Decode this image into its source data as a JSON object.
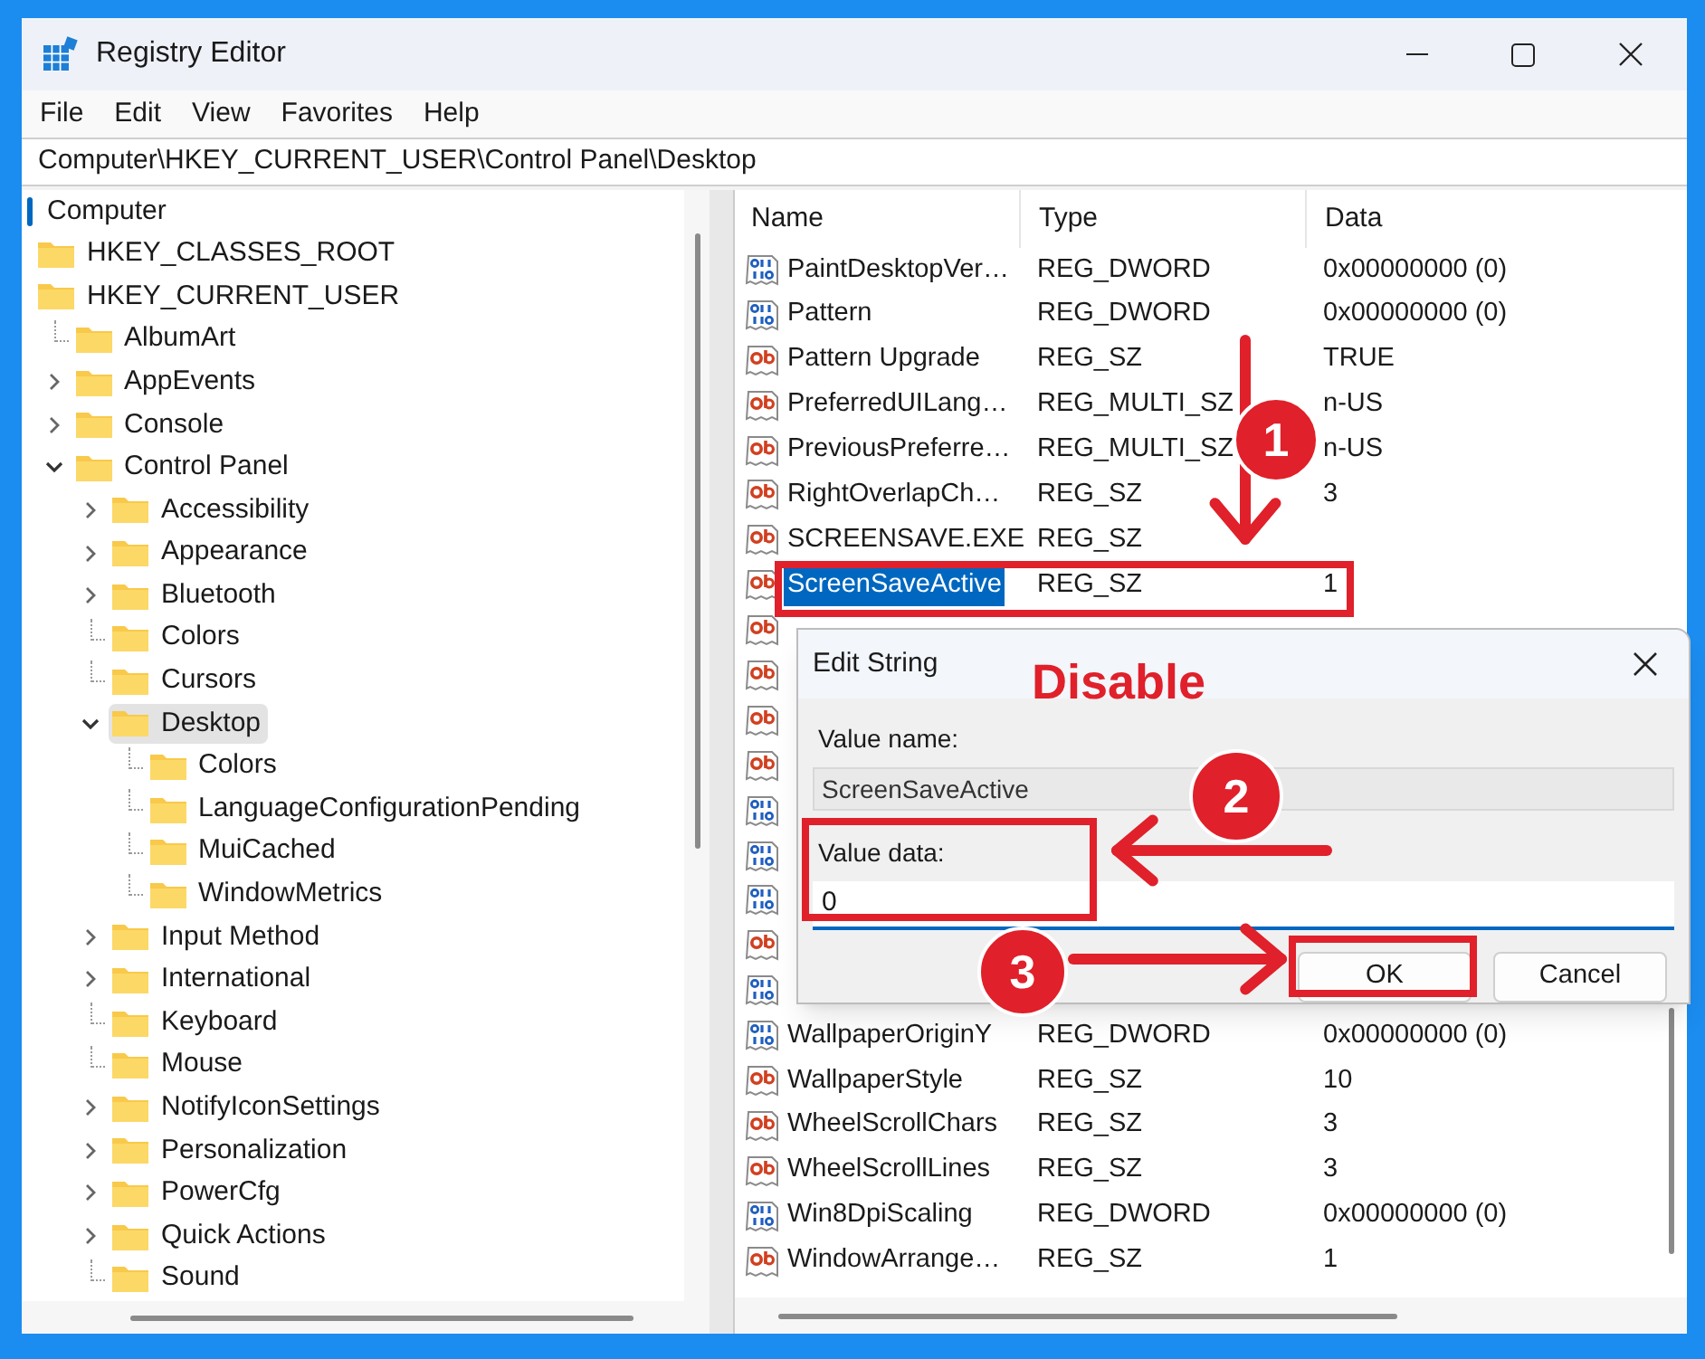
{
  "window": {
    "title": "Registry Editor"
  },
  "menu": [
    "File",
    "Edit",
    "View",
    "Favorites",
    "Help"
  ],
  "address": "Computer\\HKEY_CURRENT_USER\\Control Panel\\Desktop",
  "tree": {
    "label": "Computer",
    "selected": false,
    "children": [
      {
        "label": "HKEY_CLASSES_ROOT",
        "kind": "root",
        "selected": false
      },
      {
        "label": "HKEY_CURRENT_USER",
        "kind": "root",
        "selected": false,
        "children": [
          {
            "label": "AlbumArt",
            "kind": "leaf",
            "selected": false
          },
          {
            "label": "AppEvents",
            "kind": "branch",
            "expanded": false,
            "selected": false
          },
          {
            "label": "Console",
            "kind": "branch",
            "expanded": false,
            "selected": false
          },
          {
            "label": "Control Panel",
            "kind": "branch",
            "expanded": true,
            "selected": false,
            "children": [
              {
                "label": "Accessibility",
                "kind": "branch",
                "expanded": false,
                "selected": false
              },
              {
                "label": "Appearance",
                "kind": "branch",
                "expanded": false,
                "selected": false
              },
              {
                "label": "Bluetooth",
                "kind": "branch",
                "expanded": false,
                "selected": false
              },
              {
                "label": "Colors",
                "kind": "leaf",
                "selected": false
              },
              {
                "label": "Cursors",
                "kind": "leaf",
                "selected": false
              },
              {
                "label": "Desktop",
                "kind": "branch",
                "expanded": true,
                "selected": true,
                "children": [
                  {
                    "label": "Colors",
                    "kind": "leaf",
                    "selected": false
                  },
                  {
                    "label": "LanguageConfigurationPending",
                    "kind": "leaf",
                    "selected": false
                  },
                  {
                    "label": "MuiCached",
                    "kind": "leaf",
                    "selected": false
                  },
                  {
                    "label": "WindowMetrics",
                    "kind": "leaf",
                    "selected": false
                  }
                ]
              },
              {
                "label": "Input Method",
                "kind": "branch",
                "expanded": false,
                "selected": false
              },
              {
                "label": "International",
                "kind": "branch",
                "expanded": false,
                "selected": false
              },
              {
                "label": "Keyboard",
                "kind": "leaf",
                "selected": false
              },
              {
                "label": "Mouse",
                "kind": "leaf",
                "selected": false
              },
              {
                "label": "NotifyIconSettings",
                "kind": "branch",
                "expanded": false,
                "selected": false
              },
              {
                "label": "Personalization",
                "kind": "branch",
                "expanded": false,
                "selected": false
              },
              {
                "label": "PowerCfg",
                "kind": "branch",
                "expanded": false,
                "selected": false
              },
              {
                "label": "Quick Actions",
                "kind": "branch",
                "expanded": false,
                "selected": false
              },
              {
                "label": "Sound",
                "kind": "leaf",
                "selected": false
              }
            ]
          }
        ]
      }
    ]
  },
  "list": {
    "columns": [
      "Name",
      "Type",
      "Data"
    ],
    "rows": [
      {
        "kind": "dword",
        "name": "PaintDesktopVer…",
        "type": "REG_DWORD",
        "data": "0x00000000 (0)",
        "selected": false
      },
      {
        "kind": "dword",
        "name": "Pattern",
        "type": "REG_DWORD",
        "data": "0x00000000 (0)",
        "selected": false
      },
      {
        "kind": "string",
        "name": "Pattern Upgrade",
        "type": "REG_SZ",
        "data": "TRUE",
        "selected": false
      },
      {
        "kind": "string",
        "name": "PreferredUILang…",
        "type": "REG_MULTI_SZ",
        "data": "n-US",
        "selected": false
      },
      {
        "kind": "string",
        "name": "PreviousPreferre…",
        "type": "REG_MULTI_SZ",
        "data": "n-US",
        "selected": false
      },
      {
        "kind": "string",
        "name": "RightOverlapCh…",
        "type": "REG_SZ",
        "data": "3",
        "selected": false
      },
      {
        "kind": "string",
        "name": "SCREENSAVE.EXE",
        "type": "REG_SZ",
        "selected": false
      },
      {
        "kind": "string",
        "name": "ScreenSaveActive",
        "type": "REG_SZ",
        "data": "1",
        "selected": true
      },
      {
        "kind": "string",
        "selected": false
      },
      {
        "kind": "string",
        "selected": false
      },
      {
        "kind": "string",
        "selected": false
      },
      {
        "kind": "string",
        "selected": false
      },
      {
        "kind": "dword",
        "selected": false
      },
      {
        "kind": "dword",
        "selected": false
      },
      {
        "kind": "dword",
        "selected": false
      },
      {
        "kind": "string",
        "selected": false
      },
      {
        "kind": "dword",
        "selected": false
      },
      {
        "kind": "dword",
        "name": "WallpaperOriginY",
        "type": "REG_DWORD",
        "data": "0x00000000 (0)",
        "selected": false
      },
      {
        "kind": "string",
        "name": "WallpaperStyle",
        "type": "REG_SZ",
        "data": "10",
        "selected": false
      },
      {
        "kind": "string",
        "name": "WheelScrollChars",
        "type": "REG_SZ",
        "data": "3",
        "selected": false
      },
      {
        "kind": "string",
        "name": "WheelScrollLines",
        "type": "REG_SZ",
        "data": "3",
        "selected": false
      },
      {
        "kind": "dword",
        "name": "Win8DpiScaling",
        "type": "REG_DWORD",
        "data": "0x00000000 (0)",
        "selected": false
      },
      {
        "kind": "string",
        "name": "WindowArrange…",
        "type": "REG_SZ",
        "data": "1",
        "selected": false
      }
    ]
  },
  "dialog": {
    "title": "Edit String",
    "value_name_label": "Value name:",
    "value_name": "ScreenSaveActive",
    "value_data_label": "Value data:",
    "value_data": "0",
    "buttons": [
      "OK",
      "Cancel"
    ]
  },
  "annotations": {
    "note": "Disable",
    "steps": [
      "1",
      "2",
      "3"
    ]
  }
}
